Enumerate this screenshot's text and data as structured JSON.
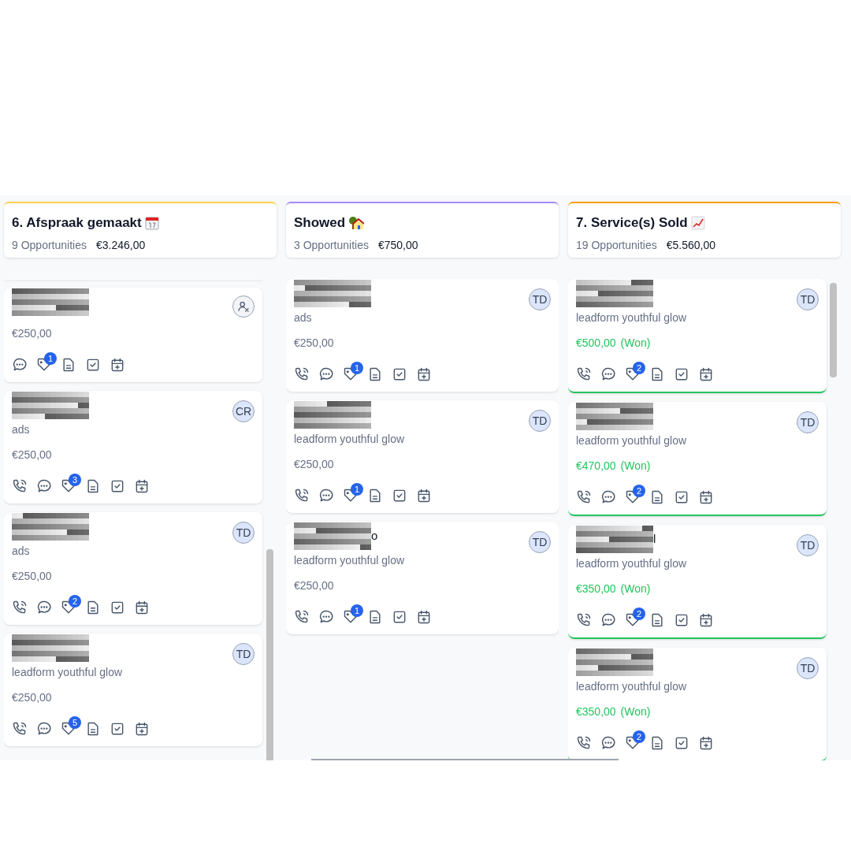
{
  "columns": [
    {
      "title": "6. Afspraak gemaakt",
      "kind": "calendar",
      "color": "#fcd34d",
      "count": "9 Opportunities",
      "total": "€3.246,00",
      "scrolled": true,
      "cards": [
        {
          "call": false,
          "amount": "€250,00",
          "won": false,
          "tasks": "1"
        },
        {
          "call": true,
          "owner": "CR",
          "source": "ads",
          "amount": "€250,00",
          "won": false,
          "tasks": "3"
        },
        {
          "call": true,
          "owner": "TD",
          "source": "ads",
          "amount": "€250,00",
          "won": false,
          "tasks": "2"
        },
        {
          "call": true,
          "owner": "TD",
          "source": "leadform youthful glow",
          "amount": "€250,00",
          "won": false,
          "tasks": "5"
        }
      ]
    },
    {
      "title": "Showed",
      "kind": "house",
      "color": "#a78bfa",
      "count": "3 Opportunities",
      "total": "€750,00",
      "cards": [
        {
          "call": true,
          "owner": "TD",
          "source": "ads",
          "amount": "€250,00",
          "won": false,
          "tasks": "1"
        },
        {
          "call": true,
          "owner": "TD",
          "source": "leadform youthful glow",
          "amount": "€250,00",
          "won": false,
          "tasks": "1"
        },
        {
          "call": true,
          "owner": "TD",
          "name_tail": "o",
          "source": "leadform youthful glow",
          "amount": "€250,00",
          "won": false,
          "tasks": "1"
        }
      ]
    },
    {
      "title": "7. Service(s) Sold",
      "kind": "chart",
      "color": "#f59e0b",
      "count": "19 Opportunities",
      "total": "€5.560,00",
      "cards": [
        {
          "call": true,
          "owner": "TD",
          "source": "leadform youthful glow",
          "amount": "€500,00",
          "won": true,
          "status_label": "(Won)",
          "tasks": "2"
        },
        {
          "call": true,
          "owner": "TD",
          "source": "leadform youthful glow",
          "amount": "€470,00",
          "won": true,
          "status_label": "(Won)",
          "tasks": "2"
        },
        {
          "call": true,
          "owner": "TD",
          "name_tail": "l",
          "source": "leadform youthful glow",
          "amount": "€350,00",
          "won": true,
          "status_label": "(Won)",
          "tasks": "2"
        },
        {
          "call": true,
          "owner": "TD",
          "source": "leadform youthful glow",
          "amount": "€350,00",
          "won": true,
          "status_label": "(Won)",
          "tasks": "2"
        }
      ]
    }
  ]
}
